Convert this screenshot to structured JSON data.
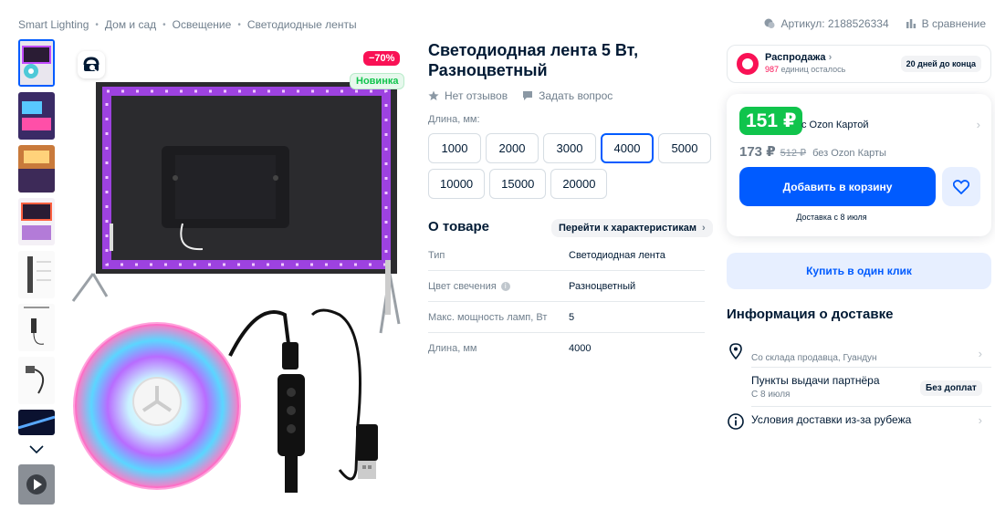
{
  "breadcrumb": [
    "Smart Lighting",
    "Дом и сад",
    "Освещение",
    "Светодиодные ленты"
  ],
  "top_actions": {
    "article": "Артикул: 2188526334",
    "compare": "В сравнение"
  },
  "badges": {
    "discount": "−70%",
    "new": "Новинка"
  },
  "product": {
    "title": "Светодиодная лента 5 Вт, Разноцветный",
    "reviews": "Нет отзывов",
    "ask": "Задать вопрос",
    "length_label": "Длина, мм:",
    "length_options": [
      "1000",
      "2000",
      "3000",
      "4000",
      "5000",
      "10000",
      "15000",
      "20000"
    ],
    "selected_length": "4000"
  },
  "about": {
    "title": "О товаре",
    "link": "Перейти к характеристикам",
    "specs": [
      {
        "key": "Тип",
        "value": "Светодиодная лента"
      },
      {
        "key": "Цвет свечения",
        "value": "Разноцветный"
      },
      {
        "key": "Макс. мощность ламп, Вт",
        "value": "5"
      },
      {
        "key": "Длина, мм",
        "value": "4000"
      }
    ]
  },
  "sale": {
    "label": "Распродажа",
    "count": "987",
    "count_suffix": " единиц осталось",
    "days": "20 дней до конца"
  },
  "price": {
    "card_price": "151 ₽",
    "card_label": "с Ozon Картой",
    "regular_price": "173 ₽",
    "old_price": "512 ₽",
    "regular_label": "без Ozon Карты",
    "cart_button": "Добавить в корзину",
    "delivery_date": "Доставка с 8 июля"
  },
  "one_click": "Купить в один клик",
  "delivery": {
    "title": "Информация о доставке",
    "warehouse": "Со склада продавца, Гуандун",
    "pickup_title": "Пункты выдачи партнёра",
    "pickup_date": "С 8 июля",
    "pickup_badge": "Без доплат",
    "abroad": "Условия доставки из-за рубежа"
  },
  "colors": {
    "accent": "#005bff",
    "sale_pink": "#f91155",
    "green": "#10c44c"
  }
}
